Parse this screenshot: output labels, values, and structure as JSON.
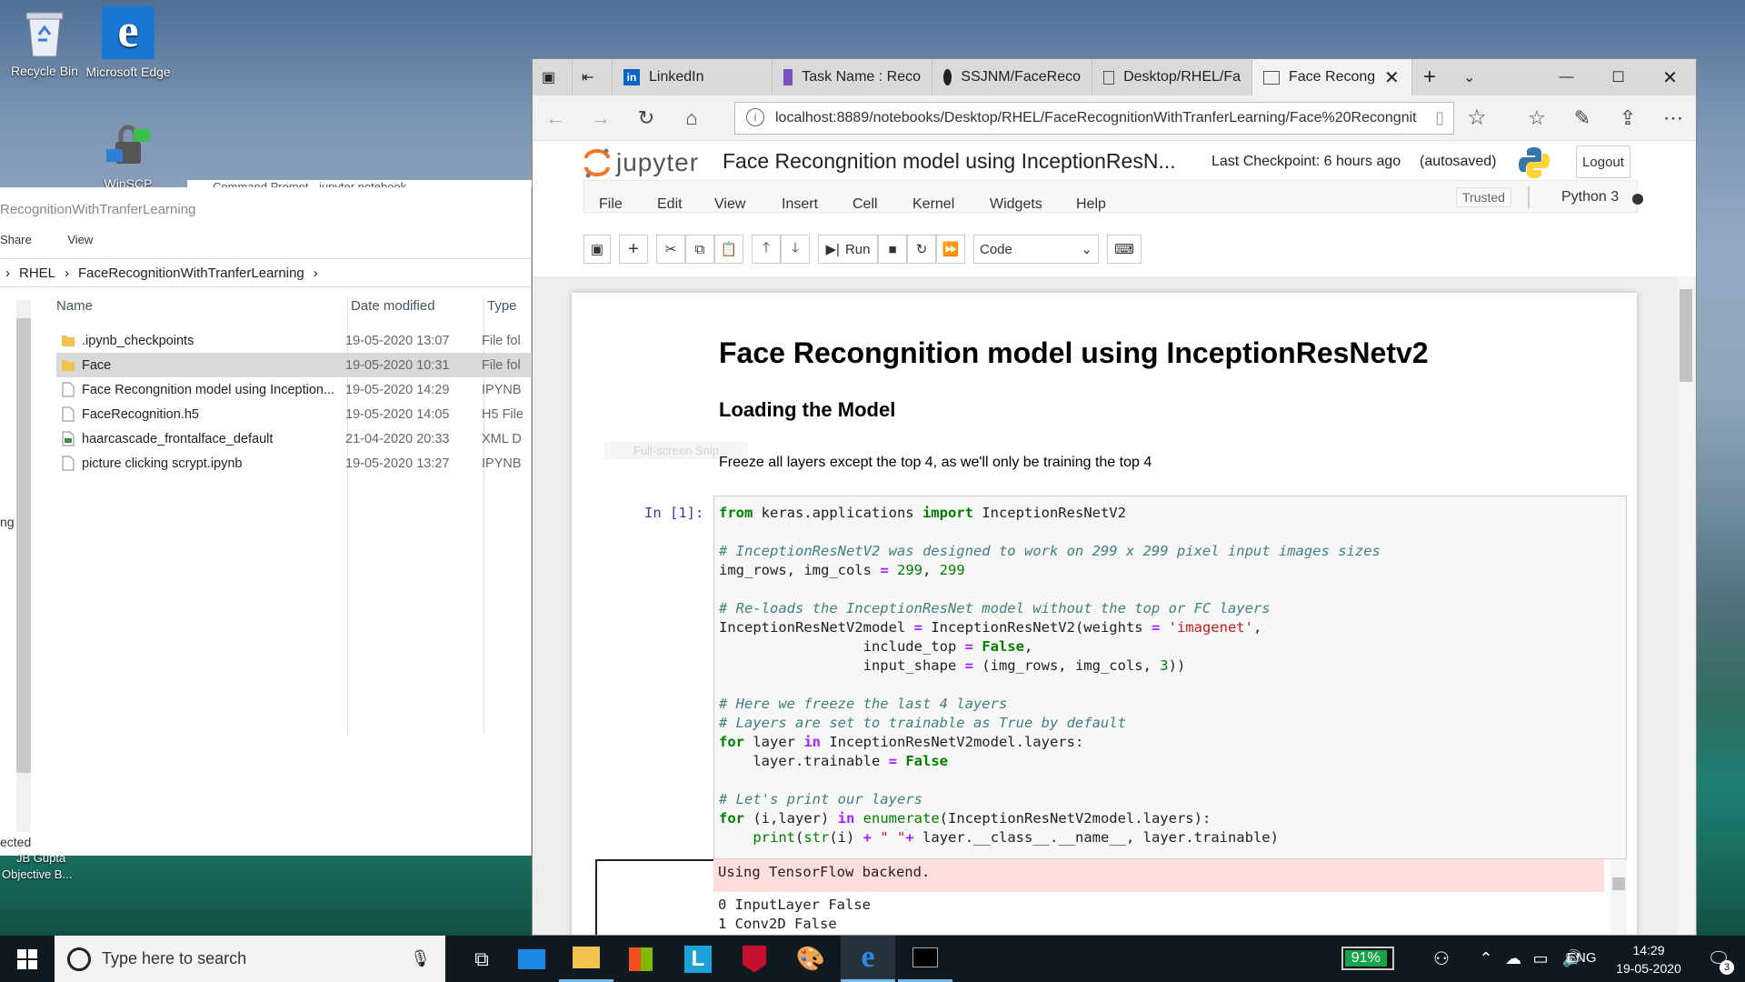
{
  "desktop": {
    "icons": [
      {
        "label": "Recycle Bin"
      },
      {
        "label": "Microsoft Edge"
      },
      {
        "label": "WinSCP"
      }
    ],
    "cmd_title": "Command Prompt - jupyter  notebook",
    "bottom_labels": [
      "JB Gupta",
      "Objective  B..."
    ],
    "side_fragments": [
      "ng",
      "ected"
    ]
  },
  "explorer": {
    "title": "RecognitionWithTranferLearning",
    "ribbon": [
      "Share",
      "View"
    ],
    "breadcrumb": [
      "RHEL",
      "FaceRecognitionWithTranferLearning"
    ],
    "columns": [
      "Name",
      "Date modified",
      "Type"
    ],
    "files": [
      {
        "name": ".ipynb_checkpoints",
        "date": "19-05-2020 13:07",
        "type": "File fol",
        "icon": "folder-icon"
      },
      {
        "name": "Face",
        "date": "19-05-2020 10:31",
        "type": "File fol",
        "icon": "folder-icon"
      },
      {
        "name": "Face Recongnition model using Inception...",
        "date": "19-05-2020 14:29",
        "type": "IPYNB",
        "icon": "file-icon"
      },
      {
        "name": "FaceRecognition.h5",
        "date": "19-05-2020 14:05",
        "type": "H5 File",
        "icon": "file-icon"
      },
      {
        "name": "haarcascade_frontalface_default",
        "date": "21-04-2020 20:33",
        "type": "XML D",
        "icon": "xml-file-icon"
      },
      {
        "name": "picture clicking scrypt.ipynb",
        "date": "19-05-2020 13:27",
        "type": "IPYNB",
        "icon": "file-icon"
      }
    ]
  },
  "browser": {
    "tabs": [
      "LinkedIn",
      "Task Name : Reco",
      "SSJNM/FaceReco",
      "Desktop/RHEL/Fa",
      "Face Recongr"
    ],
    "url": "localhost:8889/notebooks/Desktop/RHEL/FaceRecognitionWithTranferLearning/Face%20Recongnit"
  },
  "jupyter": {
    "logo_text": "jupyter",
    "notebook_title": "Face Recongnition model using InceptionResN...",
    "checkpoint": "Last Checkpoint: 6 hours ago",
    "autosaved": "(autosaved)",
    "logout": "Logout",
    "menu": [
      "File",
      "Edit",
      "View",
      "Insert",
      "Cell",
      "Kernel",
      "Widgets",
      "Help"
    ],
    "trusted": "Trusted",
    "kernel": "Python 3",
    "run_label": "Run",
    "cell_type": "Code"
  },
  "notebook": {
    "h1": "Face Recongnition model using InceptionResNetv2",
    "h2": "Loading the Model",
    "para": "Freeze all layers except the top 4, as we'll only be training the top 4",
    "ghost": "Full-screen Snip",
    "prompt": "In [1]:",
    "stderr": "Using TensorFlow backend.",
    "output": [
      "0 InputLayer False",
      "1 Conv2D False"
    ]
  },
  "taskbar": {
    "search_placeholder": "Type here to search",
    "battery": "91%",
    "lang": "ENG",
    "time": "14:29",
    "date": "19-05-2020",
    "notifications": "3"
  }
}
